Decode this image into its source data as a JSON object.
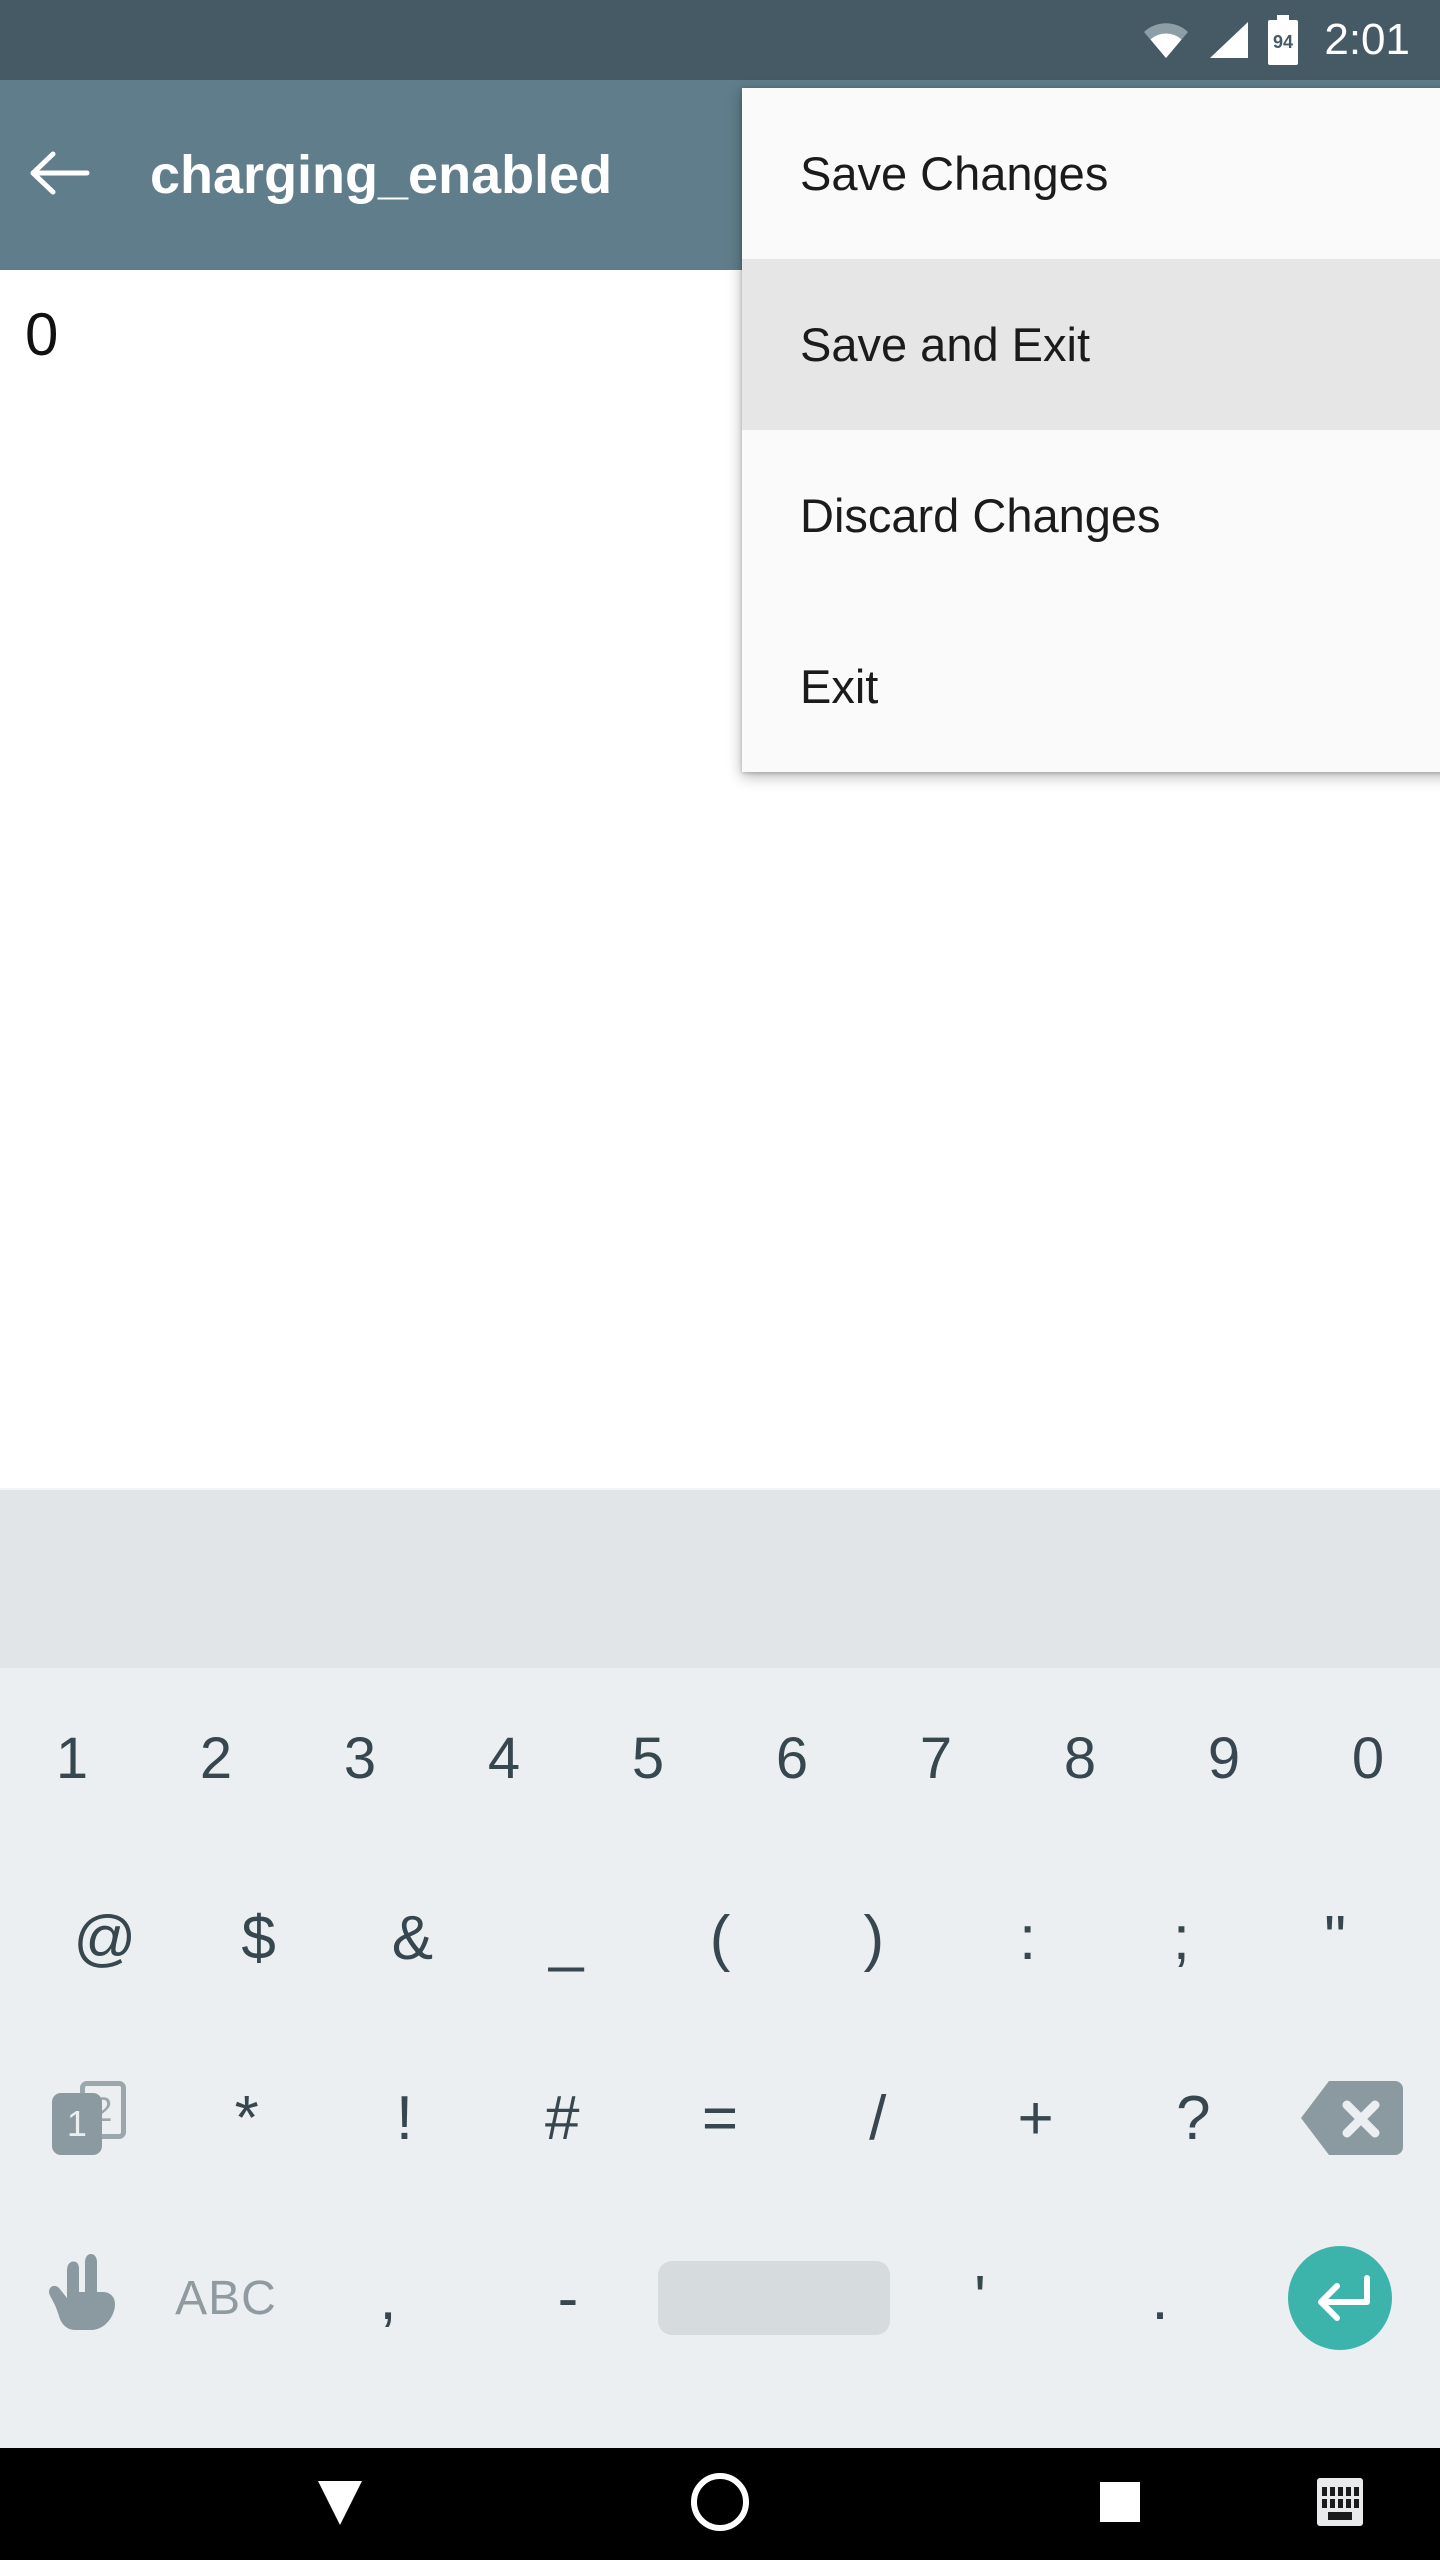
{
  "status_bar": {
    "time": "2:01",
    "battery_level": "94",
    "icons": [
      "wifi-icon",
      "cell-signal-icon",
      "battery-icon"
    ],
    "background_color": "#455a64"
  },
  "app_bar": {
    "title": "charging_enabled",
    "back_icon": "arrow-left-icon",
    "background_color": "#607d8b"
  },
  "content": {
    "value": "0"
  },
  "overflow_menu": {
    "items": [
      {
        "label": "Save Changes",
        "highlighted": false
      },
      {
        "label": "Save and Exit",
        "highlighted": true
      },
      {
        "label": "Discard Changes",
        "highlighted": false
      },
      {
        "label": "Exit",
        "highlighted": false
      }
    ],
    "background_color": "#fafafa",
    "highlight_color": "#e6e6e6"
  },
  "suggestion_strip": {
    "suggestions": [],
    "background_color": "#e1e5e8"
  },
  "keyboard": {
    "background_color": "#eceff1",
    "key_text_color": "#37474f",
    "accent_color": "#3cb4ac",
    "row1": [
      "1",
      "2",
      "3",
      "4",
      "5",
      "6",
      "7",
      "8",
      "9",
      "0"
    ],
    "row2": [
      "@",
      "$",
      "&",
      "_",
      "(",
      ")",
      ":",
      ";",
      "\""
    ],
    "row3": {
      "page_toggle": {
        "icon": "page-toggle-1-2-icon",
        "current": "1",
        "next": "2"
      },
      "keys": [
        "*",
        "!",
        "#",
        "=",
        "/",
        "+",
        "?"
      ],
      "backspace": {
        "icon": "backspace-icon"
      }
    },
    "row4": {
      "gesture": {
        "icon": "glide-typing-hand-icon"
      },
      "alpha_label": "ABC",
      "comma": ",",
      "hyphen": "-",
      "space": {
        "icon": "spacebar-icon"
      },
      "apostrophe": "'",
      "period": ".",
      "enter": {
        "icon": "enter-return-icon"
      }
    }
  },
  "nav_bar": {
    "background_color": "#000000",
    "buttons": [
      {
        "name": "hide-keyboard-back-button",
        "icon": "triangle-down-icon"
      },
      {
        "name": "home-button",
        "icon": "circle-icon"
      },
      {
        "name": "recents-button",
        "icon": "square-icon"
      },
      {
        "name": "keyboard-switcher-button",
        "icon": "keyboard-icon"
      }
    ]
  }
}
